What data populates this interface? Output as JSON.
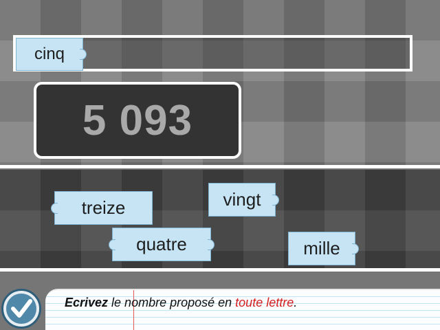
{
  "answer": {
    "tiles": [
      {
        "label": "cinq"
      }
    ]
  },
  "number": {
    "value": "5 093"
  },
  "tiles": [
    {
      "label": "treize"
    },
    {
      "label": "vingt"
    },
    {
      "label": "quatre"
    },
    {
      "label": "mille"
    }
  ],
  "instruction": {
    "verb": "Ecrivez",
    "middle": " le nombre proposé en ",
    "highlight": "toute lettre",
    "end": "."
  },
  "colors": {
    "tile": "#c6e4f4",
    "highlight": "#d42020",
    "display": "#333333"
  },
  "icons": {
    "validate": "check-icon"
  }
}
